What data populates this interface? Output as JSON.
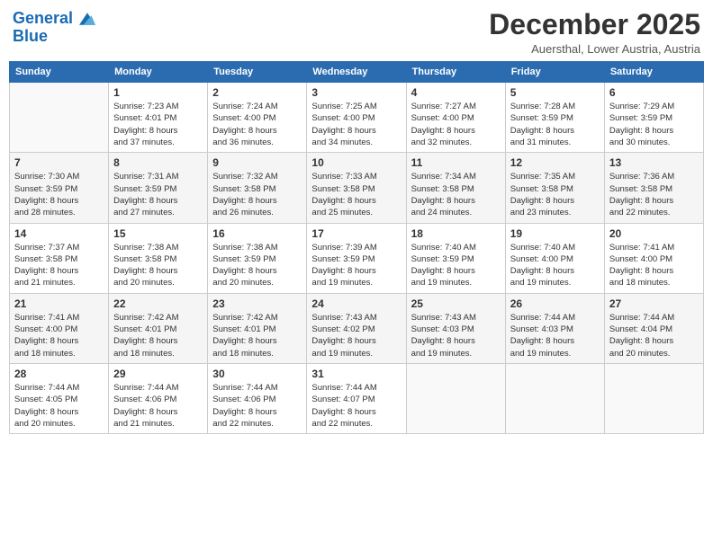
{
  "header": {
    "logo_line1": "General",
    "logo_line2": "Blue",
    "month": "December 2025",
    "location": "Auersthal, Lower Austria, Austria"
  },
  "weekdays": [
    "Sunday",
    "Monday",
    "Tuesday",
    "Wednesday",
    "Thursday",
    "Friday",
    "Saturday"
  ],
  "weeks": [
    [
      {
        "day": "",
        "info": ""
      },
      {
        "day": "1",
        "info": "Sunrise: 7:23 AM\nSunset: 4:01 PM\nDaylight: 8 hours\nand 37 minutes."
      },
      {
        "day": "2",
        "info": "Sunrise: 7:24 AM\nSunset: 4:00 PM\nDaylight: 8 hours\nand 36 minutes."
      },
      {
        "day": "3",
        "info": "Sunrise: 7:25 AM\nSunset: 4:00 PM\nDaylight: 8 hours\nand 34 minutes."
      },
      {
        "day": "4",
        "info": "Sunrise: 7:27 AM\nSunset: 4:00 PM\nDaylight: 8 hours\nand 32 minutes."
      },
      {
        "day": "5",
        "info": "Sunrise: 7:28 AM\nSunset: 3:59 PM\nDaylight: 8 hours\nand 31 minutes."
      },
      {
        "day": "6",
        "info": "Sunrise: 7:29 AM\nSunset: 3:59 PM\nDaylight: 8 hours\nand 30 minutes."
      }
    ],
    [
      {
        "day": "7",
        "info": "Sunrise: 7:30 AM\nSunset: 3:59 PM\nDaylight: 8 hours\nand 28 minutes."
      },
      {
        "day": "8",
        "info": "Sunrise: 7:31 AM\nSunset: 3:59 PM\nDaylight: 8 hours\nand 27 minutes."
      },
      {
        "day": "9",
        "info": "Sunrise: 7:32 AM\nSunset: 3:58 PM\nDaylight: 8 hours\nand 26 minutes."
      },
      {
        "day": "10",
        "info": "Sunrise: 7:33 AM\nSunset: 3:58 PM\nDaylight: 8 hours\nand 25 minutes."
      },
      {
        "day": "11",
        "info": "Sunrise: 7:34 AM\nSunset: 3:58 PM\nDaylight: 8 hours\nand 24 minutes."
      },
      {
        "day": "12",
        "info": "Sunrise: 7:35 AM\nSunset: 3:58 PM\nDaylight: 8 hours\nand 23 minutes."
      },
      {
        "day": "13",
        "info": "Sunrise: 7:36 AM\nSunset: 3:58 PM\nDaylight: 8 hours\nand 22 minutes."
      }
    ],
    [
      {
        "day": "14",
        "info": "Sunrise: 7:37 AM\nSunset: 3:58 PM\nDaylight: 8 hours\nand 21 minutes."
      },
      {
        "day": "15",
        "info": "Sunrise: 7:38 AM\nSunset: 3:58 PM\nDaylight: 8 hours\nand 20 minutes."
      },
      {
        "day": "16",
        "info": "Sunrise: 7:38 AM\nSunset: 3:59 PM\nDaylight: 8 hours\nand 20 minutes."
      },
      {
        "day": "17",
        "info": "Sunrise: 7:39 AM\nSunset: 3:59 PM\nDaylight: 8 hours\nand 19 minutes."
      },
      {
        "day": "18",
        "info": "Sunrise: 7:40 AM\nSunset: 3:59 PM\nDaylight: 8 hours\nand 19 minutes."
      },
      {
        "day": "19",
        "info": "Sunrise: 7:40 AM\nSunset: 4:00 PM\nDaylight: 8 hours\nand 19 minutes."
      },
      {
        "day": "20",
        "info": "Sunrise: 7:41 AM\nSunset: 4:00 PM\nDaylight: 8 hours\nand 18 minutes."
      }
    ],
    [
      {
        "day": "21",
        "info": "Sunrise: 7:41 AM\nSunset: 4:00 PM\nDaylight: 8 hours\nand 18 minutes."
      },
      {
        "day": "22",
        "info": "Sunrise: 7:42 AM\nSunset: 4:01 PM\nDaylight: 8 hours\nand 18 minutes."
      },
      {
        "day": "23",
        "info": "Sunrise: 7:42 AM\nSunset: 4:01 PM\nDaylight: 8 hours\nand 18 minutes."
      },
      {
        "day": "24",
        "info": "Sunrise: 7:43 AM\nSunset: 4:02 PM\nDaylight: 8 hours\nand 19 minutes."
      },
      {
        "day": "25",
        "info": "Sunrise: 7:43 AM\nSunset: 4:03 PM\nDaylight: 8 hours\nand 19 minutes."
      },
      {
        "day": "26",
        "info": "Sunrise: 7:44 AM\nSunset: 4:03 PM\nDaylight: 8 hours\nand 19 minutes."
      },
      {
        "day": "27",
        "info": "Sunrise: 7:44 AM\nSunset: 4:04 PM\nDaylight: 8 hours\nand 20 minutes."
      }
    ],
    [
      {
        "day": "28",
        "info": "Sunrise: 7:44 AM\nSunset: 4:05 PM\nDaylight: 8 hours\nand 20 minutes."
      },
      {
        "day": "29",
        "info": "Sunrise: 7:44 AM\nSunset: 4:06 PM\nDaylight: 8 hours\nand 21 minutes."
      },
      {
        "day": "30",
        "info": "Sunrise: 7:44 AM\nSunset: 4:06 PM\nDaylight: 8 hours\nand 22 minutes."
      },
      {
        "day": "31",
        "info": "Sunrise: 7:44 AM\nSunset: 4:07 PM\nDaylight: 8 hours\nand 22 minutes."
      },
      {
        "day": "",
        "info": ""
      },
      {
        "day": "",
        "info": ""
      },
      {
        "day": "",
        "info": ""
      }
    ]
  ]
}
